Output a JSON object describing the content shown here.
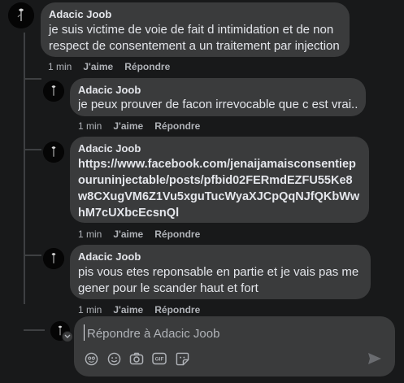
{
  "comments": [
    {
      "author": "Adacic Joob",
      "text": "je suis victime de voie de fait d intimidation et de non respect de consentement a un traitement par injection",
      "time": "1 min",
      "like": "J'aime",
      "reply": "Répondre"
    },
    {
      "author": "Adacic Joob",
      "text": "je peux prouver de facon irrevocable que c est vrai...",
      "time": "1 min",
      "like": "J'aime",
      "reply": "Répondre"
    },
    {
      "author": "Adacic Joob",
      "text": "https://www.facebook.com/jenaijamaisconsentiepouruninjectable/posts/pfbid02FERmdEZFU55Ke8w8CXugVM6Z1Vu5xguTucWyaXJCpQqNJfQKbWwhM7cUXbcEcsnQl",
      "time": "1 min",
      "like": "J'aime",
      "reply": "Répondre"
    },
    {
      "author": "Adacic Joob",
      "text": "pis vous etes reponsable en partie et je vais pas me gener pour le scander haut et fort",
      "time": "1 min",
      "like": "J'aime",
      "reply": "Répondre"
    }
  ],
  "reply_box": {
    "placeholder": "Répondre à Adacic Joob",
    "tools": [
      "avatar-sticker-icon",
      "emoji-icon",
      "camera-icon",
      "gif-icon",
      "sticker-icon"
    ],
    "gif_label": "GIF"
  },
  "colors": {
    "background": "#18191a",
    "bubble": "#3a3b3c",
    "text": "#e4e6eb",
    "secondary": "#b0b3b8"
  }
}
